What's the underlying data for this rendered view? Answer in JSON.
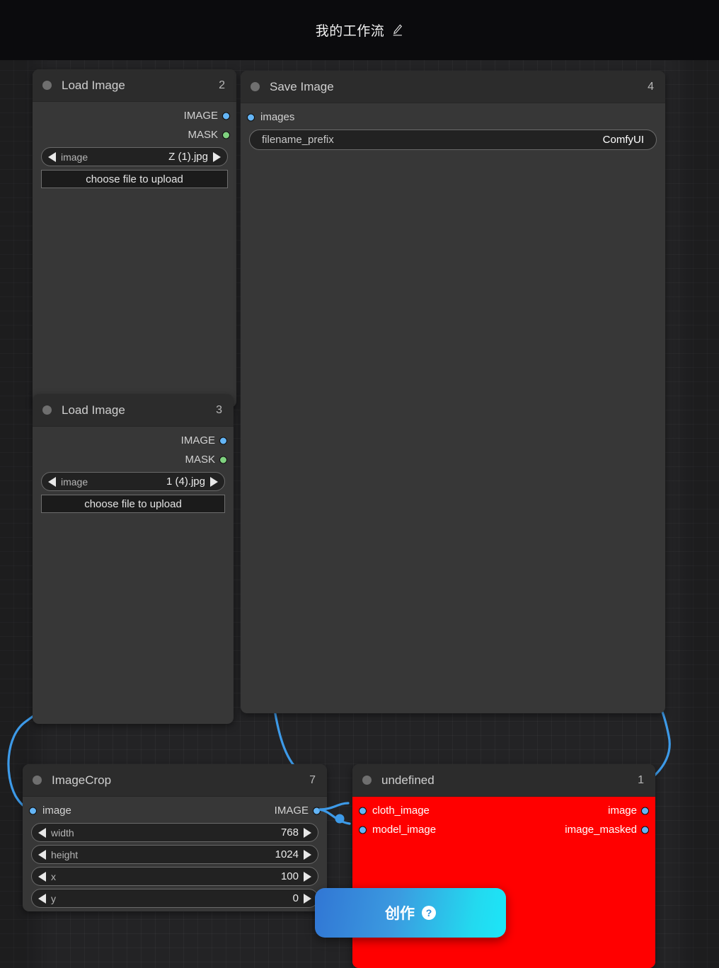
{
  "header": {
    "title": "我的工作流",
    "edit_icon": "pencil-icon"
  },
  "nodes": [
    {
      "key": "load_image_2",
      "title": "Load Image",
      "id": "2",
      "outputs": [
        {
          "label": "IMAGE",
          "type": "IMAGE",
          "color": "#64b5f6"
        },
        {
          "label": "MASK",
          "type": "MASK",
          "color": "#7fd17f"
        }
      ],
      "widgets": [
        {
          "kind": "combo",
          "name": "image",
          "value": "Z (1).jpg"
        },
        {
          "kind": "button",
          "label": "choose file to upload"
        }
      ]
    },
    {
      "key": "save_image_4",
      "title": "Save Image",
      "id": "4",
      "inputs": [
        {
          "label": "images",
          "type": "IMAGE",
          "color": "#64b5f6"
        }
      ],
      "widgets": [
        {
          "kind": "text",
          "name": "filename_prefix",
          "value": "ComfyUI"
        }
      ]
    },
    {
      "key": "load_image_3",
      "title": "Load Image",
      "id": "3",
      "outputs": [
        {
          "label": "IMAGE",
          "type": "IMAGE",
          "color": "#64b5f6"
        },
        {
          "label": "MASK",
          "type": "MASK",
          "color": "#7fd17f"
        }
      ],
      "widgets": [
        {
          "kind": "combo",
          "name": "image",
          "value": "1 (4).jpg"
        },
        {
          "kind": "button",
          "label": "choose file to upload"
        }
      ]
    },
    {
      "key": "image_crop_7",
      "title": "ImageCrop",
      "id": "7",
      "inputs": [
        {
          "label": "image",
          "type": "IMAGE",
          "color": "#64b5f6"
        }
      ],
      "outputs": [
        {
          "label": "IMAGE",
          "type": "IMAGE",
          "color": "#64b5f6"
        }
      ],
      "widgets": [
        {
          "kind": "combo",
          "name": "width",
          "value": "768"
        },
        {
          "kind": "combo",
          "name": "height",
          "value": "1024"
        },
        {
          "kind": "combo",
          "name": "x",
          "value": "100"
        },
        {
          "kind": "combo",
          "name": "y",
          "value": "0"
        }
      ]
    },
    {
      "key": "undefined_1",
      "title": "undefined",
      "id": "1",
      "error": true,
      "error_color": "#ff0000",
      "inputs": [
        {
          "label": "cloth_image",
          "type": "IMAGE",
          "color": "#64b5f6"
        },
        {
          "label": "model_image",
          "type": "IMAGE",
          "color": "#64b5f6"
        }
      ],
      "outputs": [
        {
          "label": "image",
          "type": "IMAGE",
          "color": "#64b5f6"
        },
        {
          "label": "image_masked",
          "type": "IMAGE",
          "color": "#64b5f6"
        }
      ]
    }
  ],
  "create_button": {
    "label": "创作",
    "help_icon": "question-mark-icon",
    "gradient_from": "#3176d4",
    "gradient_to": "#1ce6f8"
  },
  "canvas": {
    "link_color": "#3d9ae8",
    "background": "#232325"
  }
}
